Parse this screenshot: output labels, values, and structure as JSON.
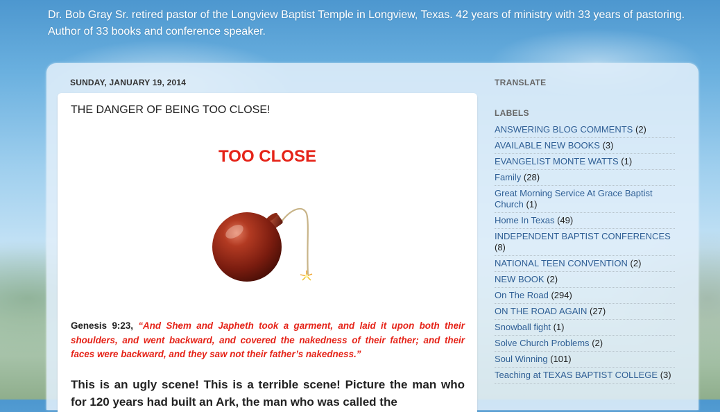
{
  "header": {
    "description": "Dr. Bob Gray Sr. retired pastor of the Longview Baptist Temple in Longview, Texas. 42 years of ministry with 33 years of pastoring. Author of 33 books and conference speaker."
  },
  "post": {
    "date": "SUNDAY, JANUARY 19, 2014",
    "title": "THE DANGER OF BEING TOO CLOSE!",
    "heading": "TOO CLOSE",
    "image_icon": "bomb-icon",
    "scripture_ref": "Genesis 9:23, ",
    "scripture_quote": "“And Shem and Japheth took a garment, and laid it upon both their shoulders, and went backward, and covered the nakedness of their father; and their faces were backward, and they saw not their father’s nakedness.”",
    "body": "This is an ugly scene! This is a terrible scene! Picture the man who for 120 years had built an Ark, the man who was called the"
  },
  "sidebar": {
    "translate_title": "TRANSLATE",
    "labels_title": "LABELS",
    "labels": [
      {
        "name": "ANSWERING BLOG COMMENTS",
        "count": "(2)"
      },
      {
        "name": "AVAILABLE NEW BOOKS",
        "count": "(3)"
      },
      {
        "name": "EVANGELIST MONTE WATTS",
        "count": "(1)"
      },
      {
        "name": "Family",
        "count": "(28)"
      },
      {
        "name": "Great Morning Service At Grace Baptist Church",
        "count": "(1)"
      },
      {
        "name": "Home In Texas",
        "count": "(49)"
      },
      {
        "name": "INDEPENDENT BAPTIST CONFERENCES",
        "count": "(8)"
      },
      {
        "name": "NATIONAL TEEN CONVENTION",
        "count": "(2)"
      },
      {
        "name": "NEW BOOK",
        "count": "(2)"
      },
      {
        "name": "On The Road",
        "count": "(294)"
      },
      {
        "name": "ON THE ROAD AGAIN",
        "count": "(27)"
      },
      {
        "name": "Snowball fight",
        "count": "(1)"
      },
      {
        "name": "Solve Church Problems",
        "count": "(2)"
      },
      {
        "name": "Soul Winning",
        "count": "(101)"
      },
      {
        "name": "Teaching at TEXAS BAPTIST COLLEGE",
        "count": "(3)"
      }
    ]
  },
  "colors": {
    "heading_red": "#e52318",
    "link_blue": "#2f5f95"
  }
}
